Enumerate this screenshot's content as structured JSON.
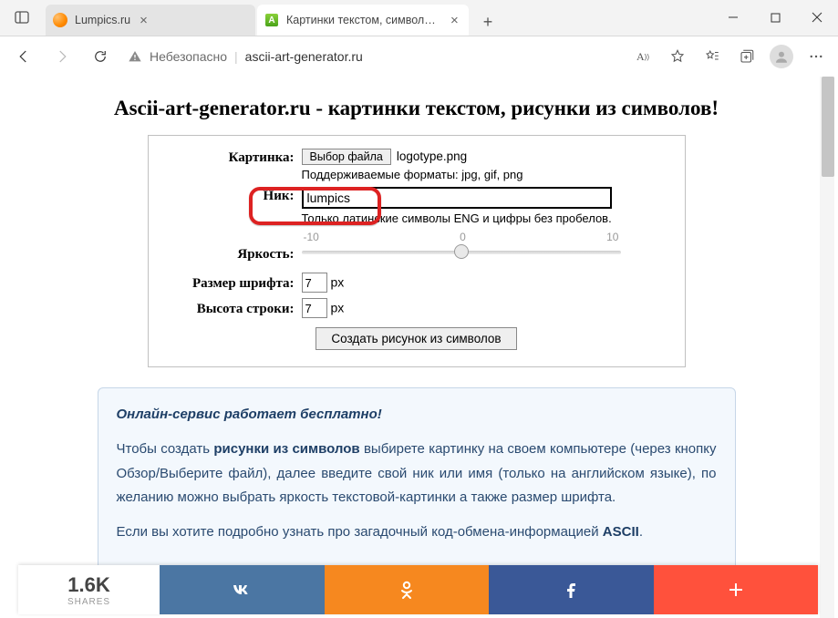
{
  "browser": {
    "tabs": [
      {
        "title": "Lumpics.ru",
        "active": false
      },
      {
        "title": "Картинки текстом, символами.",
        "active": true
      }
    ],
    "new_tab_symbol": "+",
    "insecure_label": "Небезопасно",
    "url_host": "ascii-art-generator.ru",
    "read_aloud": "A))",
    "win": {
      "min": "—",
      "max": "▢",
      "close": "✕"
    }
  },
  "page": {
    "title": "Ascii-art-generator.ru - картинки текстом, рисунки из символов!",
    "form": {
      "image_label": "Картинка:",
      "file_button": "Выбор файла",
      "file_name": "logotype.png",
      "image_hint": "Поддерживаемые форматы: jpg, gif, png",
      "nick_label": "Ник:",
      "nick_value": "lumpics",
      "nick_hint": "Только латинские символы ENG и цифры без пробелов.",
      "brightness_label": "Яркость:",
      "slider_min": "-10",
      "slider_mid": "0",
      "slider_max": "10",
      "font_label": "Размер шрифта:",
      "font_value": "7",
      "px": "px",
      "line_label": "Высота строки:",
      "line_value": "7",
      "submit": "Создать рисунок из символов"
    },
    "info": {
      "header": "Онлайн-сервис работает бесплатно!",
      "p1_a": "Чтобы создать ",
      "p1_b": "рисунки из символов",
      "p1_c": " выбирете картинку на своем компьютере (через кнопку Обзор/Выберите файл), далее введите свой ник или имя (только на английском языке), по желанию можно выбрать яркость текстовой-картинки а также размер шрифта.",
      "p2_a": "Если вы хотите подробно узнать про загадочный код-обмена-информацией ",
      "p2_b": "ASCII"
    }
  },
  "share": {
    "count": "1.6K",
    "label": "SHARES"
  }
}
